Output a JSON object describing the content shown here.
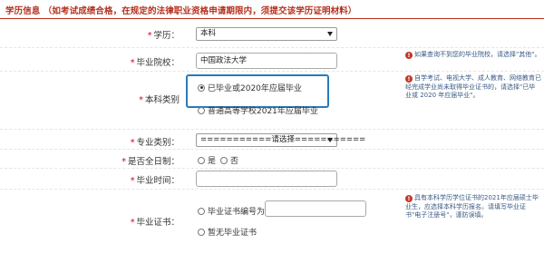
{
  "header": {
    "title": "学历信息 （如考试成绩合格，在规定的法律职业资格申请期限内，须提交该学历证明材料）"
  },
  "form": {
    "education": {
      "label": "学历：",
      "value": "本科"
    },
    "school": {
      "label": "毕业院校：",
      "value": "中国政法大学",
      "hint": "如果查询不到您的毕业院校，请选择\"其他\"。"
    },
    "category": {
      "label": "本科类别",
      "options": [
        "已毕业或2020年应届毕业",
        "普通高等学校2021年应届毕业"
      ],
      "hint": "自学考试、电视大学、成人教育、网络教育已经完成学业尚未取得毕业证书的，请选择\"已毕业或 2020 年应届毕业\"。"
    },
    "major": {
      "label": "专业类别：",
      "value": "===========请选择==========="
    },
    "fulltime": {
      "label": "是否全日制：",
      "options": [
        "是",
        "否"
      ]
    },
    "grad_time": {
      "label": "毕业时间：",
      "value": ""
    },
    "certificate": {
      "label": "毕业证书：",
      "options": [
        "毕业证书编号为",
        "暂无毕业证书"
      ],
      "number": "",
      "hint": "具有本科学历学位证书的2021年应届硕士毕业生，应选择本科学历报名。请填写毕业证书\"电子注册号\"，谨防误填。"
    }
  },
  "icons": {
    "dropdown": "chevron-down-icon",
    "hint": "info-icon"
  },
  "colors": {
    "header": "#b5301e",
    "required": "#d0021b",
    "hint_text": "#3a5a85",
    "focus": "#2a7ab8"
  }
}
